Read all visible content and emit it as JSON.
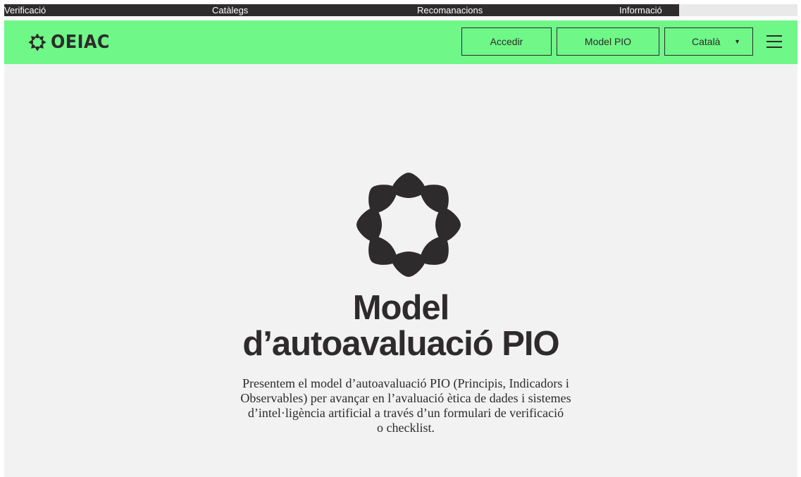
{
  "top_nav": {
    "items": [
      {
        "label": "Verificació"
      },
      {
        "label": "Catàlegs"
      },
      {
        "label": "Recomanacions"
      },
      {
        "label": "Informació"
      }
    ]
  },
  "header": {
    "logo_text": "OEIAC",
    "login_label": "Accedir",
    "model_label": "Model PIO",
    "language": {
      "selected": "Català",
      "caret": "▼"
    },
    "menu_icon": "hamburger-icon",
    "background_color": "#6ff788"
  },
  "hero": {
    "title_line1": "Model",
    "title_line2": "d’autoavaluació PIO",
    "description_lines": [
      "Presentem el model d’autoavaluació PIO (Principis, Indicadors i",
      "Observables) per avançar en l’avaluació ètica de dades i sistemes",
      "d’intel·ligència artificial a través d’un formulari de verificació",
      "o checklist."
    ],
    "logo_icon": "oeiac-petals-icon",
    "background_color": "#f2f2f2"
  },
  "colors": {
    "dark": "#2d2b2b",
    "top_bar": "#2f2c2d"
  }
}
